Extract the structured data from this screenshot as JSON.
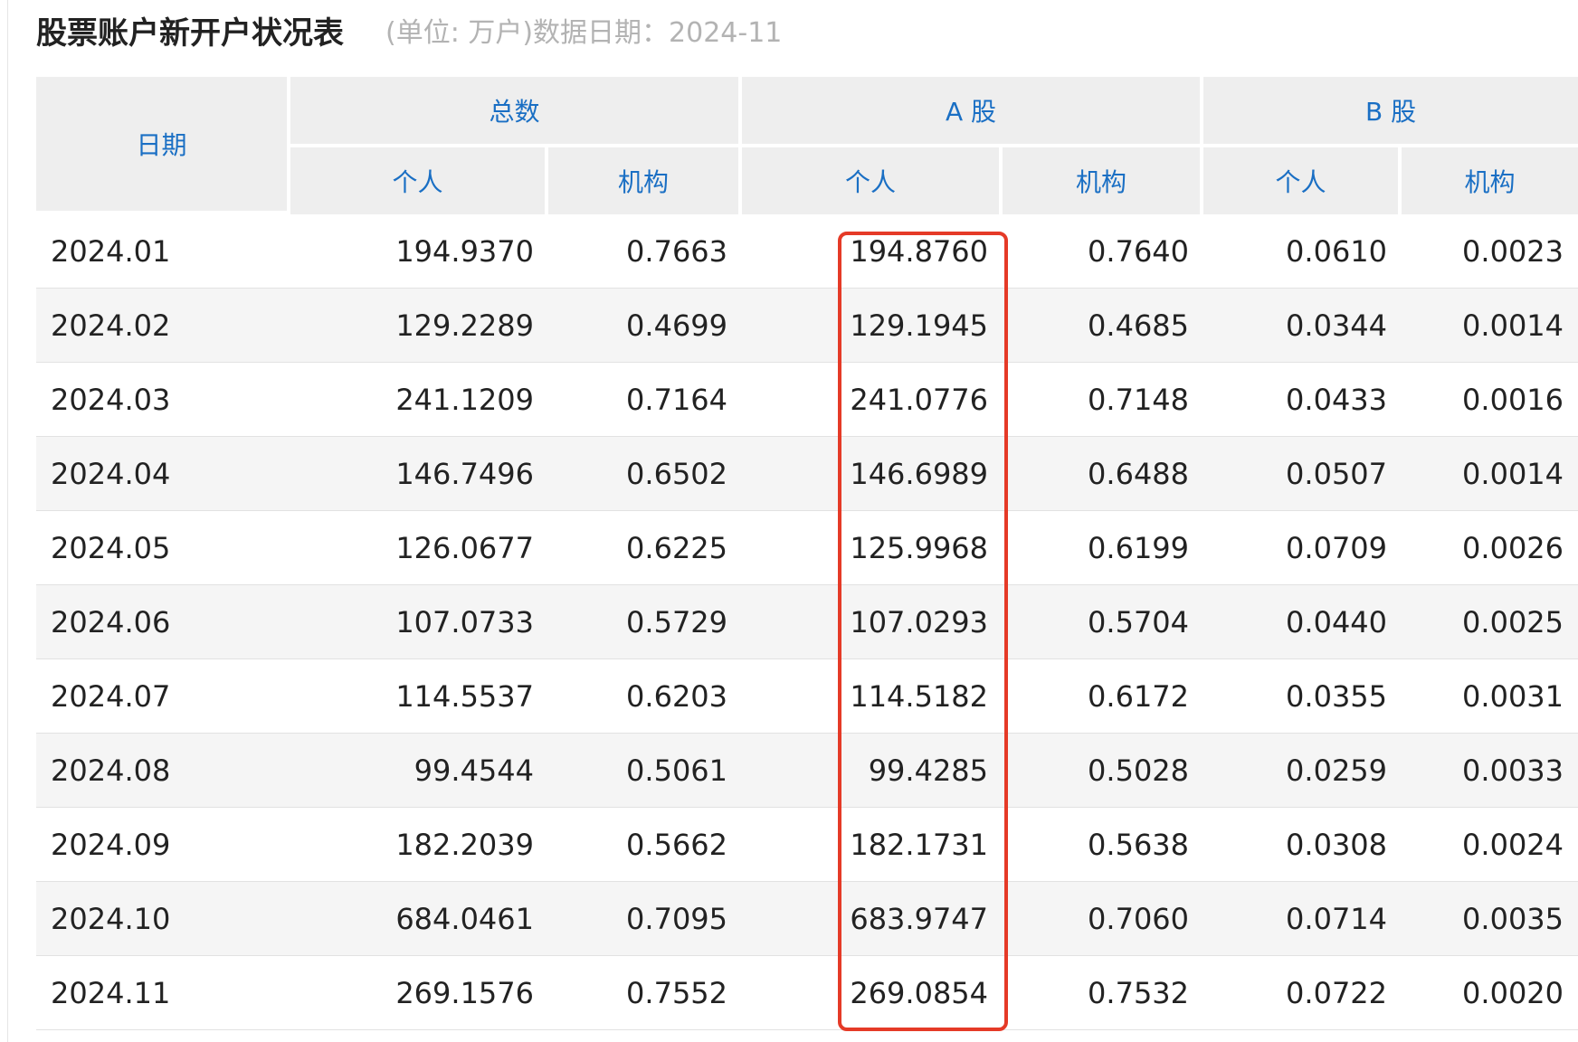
{
  "header": {
    "title": "股票账户新开户状况表",
    "subtitle": "(单位: 万户)数据日期：2024-11"
  },
  "table": {
    "columns": {
      "date": "日期",
      "total": "总数",
      "a_share": "A 股",
      "b_share": "B 股",
      "individual": "个人",
      "institution": "机构"
    },
    "rows": [
      {
        "date": "2024.01",
        "total_ind": "194.9370",
        "total_inst": "0.7663",
        "a_ind": "194.8760",
        "a_inst": "0.7640",
        "b_ind": "0.0610",
        "b_inst": "0.0023"
      },
      {
        "date": "2024.02",
        "total_ind": "129.2289",
        "total_inst": "0.4699",
        "a_ind": "129.1945",
        "a_inst": "0.4685",
        "b_ind": "0.0344",
        "b_inst": "0.0014"
      },
      {
        "date": "2024.03",
        "total_ind": "241.1209",
        "total_inst": "0.7164",
        "a_ind": "241.0776",
        "a_inst": "0.7148",
        "b_ind": "0.0433",
        "b_inst": "0.0016"
      },
      {
        "date": "2024.04",
        "total_ind": "146.7496",
        "total_inst": "0.6502",
        "a_ind": "146.6989",
        "a_inst": "0.6488",
        "b_ind": "0.0507",
        "b_inst": "0.0014"
      },
      {
        "date": "2024.05",
        "total_ind": "126.0677",
        "total_inst": "0.6225",
        "a_ind": "125.9968",
        "a_inst": "0.6199",
        "b_ind": "0.0709",
        "b_inst": "0.0026"
      },
      {
        "date": "2024.06",
        "total_ind": "107.0733",
        "total_inst": "0.5729",
        "a_ind": "107.0293",
        "a_inst": "0.5704",
        "b_ind": "0.0440",
        "b_inst": "0.0025"
      },
      {
        "date": "2024.07",
        "total_ind": "114.5537",
        "total_inst": "0.6203",
        "a_ind": "114.5182",
        "a_inst": "0.6172",
        "b_ind": "0.0355",
        "b_inst": "0.0031"
      },
      {
        "date": "2024.08",
        "total_ind": "99.4544",
        "total_inst": "0.5061",
        "a_ind": "99.4285",
        "a_inst": "0.5028",
        "b_ind": "0.0259",
        "b_inst": "0.0033"
      },
      {
        "date": "2024.09",
        "total_ind": "182.2039",
        "total_inst": "0.5662",
        "a_ind": "182.1731",
        "a_inst": "0.5638",
        "b_ind": "0.0308",
        "b_inst": "0.0024"
      },
      {
        "date": "2024.10",
        "total_ind": "684.0461",
        "total_inst": "0.7095",
        "a_ind": "683.9747",
        "a_inst": "0.7060",
        "b_ind": "0.0714",
        "b_inst": "0.0035"
      },
      {
        "date": "2024.11",
        "total_ind": "269.1576",
        "total_inst": "0.7552",
        "a_ind": "269.0854",
        "a_inst": "0.7532",
        "b_ind": "0.0722",
        "b_inst": "0.0020"
      }
    ]
  },
  "colors": {
    "header_text": "#1a6fc4",
    "header_bg": "#eeeeee",
    "stripe_bg": "#f5f5f5",
    "highlight_border": "#e53a27"
  }
}
